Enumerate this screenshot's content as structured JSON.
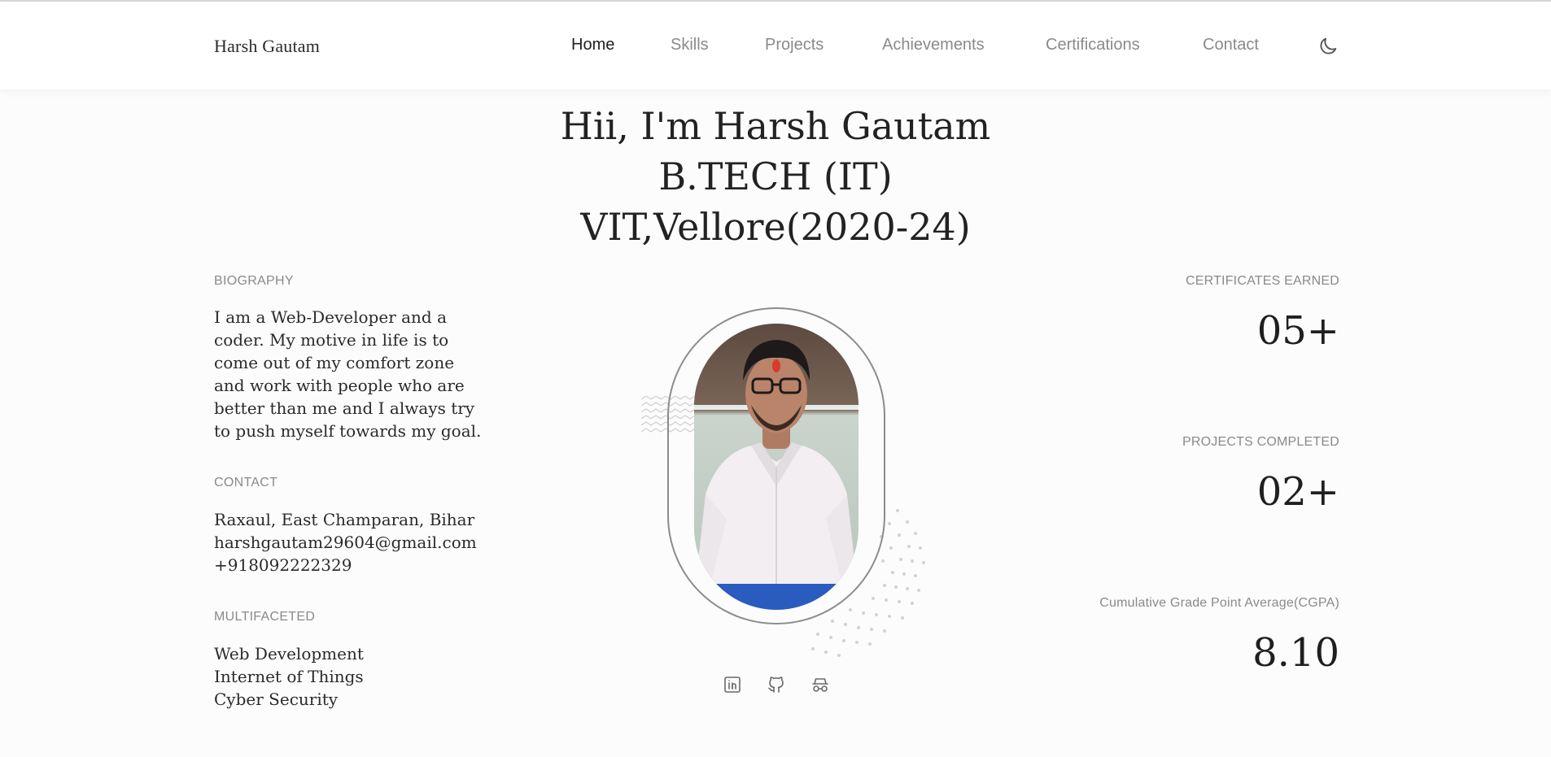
{
  "header": {
    "brand": "Harsh Gautam",
    "nav": [
      "Home",
      "Skills",
      "Projects",
      "Achievements",
      "Certifications",
      "Contact"
    ],
    "active": "Home",
    "theme_icon": "moon-icon"
  },
  "hero": {
    "line1": "Hii, I'm Harsh Gautam",
    "line2": "B.TECH (IT)",
    "line3": "VIT,Vellore(2020-24)"
  },
  "biography": {
    "label": "BIOGRAPHY",
    "text": "I am a Web-Developer and a coder. My motive in life is to come out of my comfort zone and work with people who are better than me and I always try to push myself towards my goal."
  },
  "contact": {
    "label": "CONTACT",
    "address": "Raxaul, East Champaran, Bihar",
    "email": "harshgautam29604@gmail.com",
    "phone": "+918092222329"
  },
  "multifaceted": {
    "label": "MULTIFACETED",
    "items": [
      "Web Development",
      "Internet of Things",
      "Cyber Security"
    ]
  },
  "stats": {
    "certificates": {
      "label": "CERTIFICATES EARNED",
      "value": "05+"
    },
    "projects": {
      "label": "PROJECTS COMPLETED",
      "value": "02+"
    },
    "cgpa": {
      "label": "Cumulative Grade Point Average(CGPA)",
      "value": "8.10"
    }
  },
  "socials": [
    "linkedin-icon",
    "github-icon",
    "incognito-icon"
  ],
  "colors": {
    "background": "#fcfcfc",
    "muted_text": "#8a8a8a",
    "text": "#1f1f1f",
    "ring": "#8c8c8c"
  }
}
